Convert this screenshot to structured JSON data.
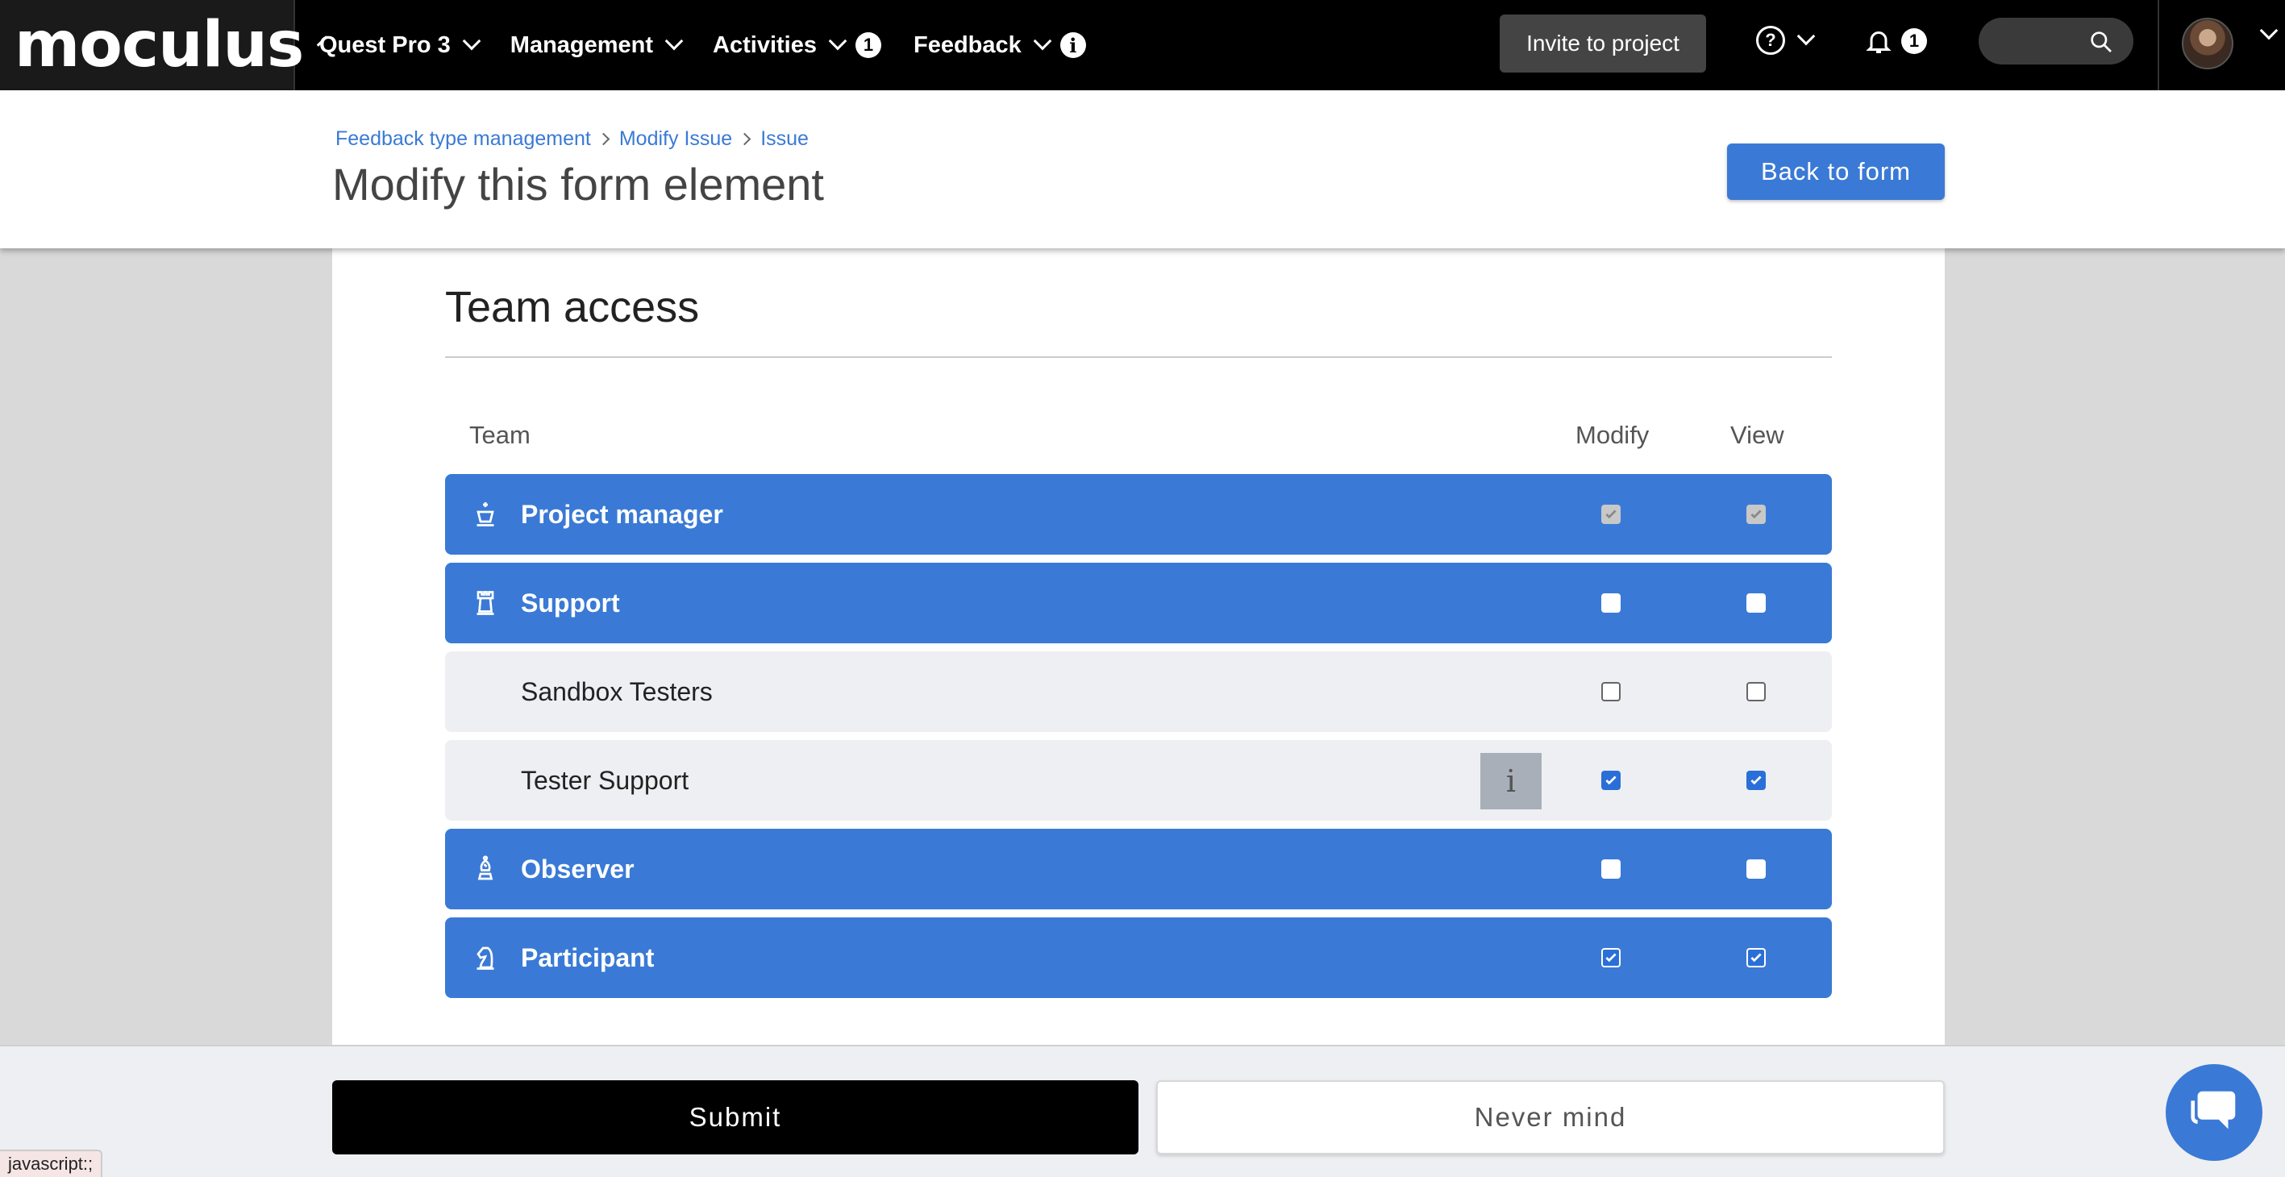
{
  "topbar": {
    "logo": "moculus",
    "nav": [
      {
        "label": "Quest Pro 3"
      },
      {
        "label": "Management"
      },
      {
        "label": "Activities",
        "badge": "1"
      },
      {
        "label": "Feedback",
        "info": "i"
      }
    ],
    "invite_label": "Invite to project",
    "help_glyph": "?",
    "notification_count": "1",
    "search_icon": "search-icon"
  },
  "header": {
    "breadcrumb": [
      "Feedback type management",
      "Modify Issue",
      "Issue"
    ],
    "title": "Modify this form element",
    "back_label": "Back to form"
  },
  "team_access": {
    "title": "Team access",
    "columns": {
      "team": "Team",
      "modify": "Modify",
      "view": "View"
    },
    "rows": [
      {
        "name": "Project manager",
        "style": "blue",
        "icon": "crown-icon",
        "modify": "checked-disabled",
        "view": "checked-disabled"
      },
      {
        "name": "Support",
        "style": "blue",
        "icon": "rook-icon",
        "modify": "unchecked",
        "view": "unchecked"
      },
      {
        "name": "Sandbox Testers",
        "style": "grey",
        "icon": "",
        "modify": "unchecked",
        "view": "unchecked"
      },
      {
        "name": "Tester Support",
        "style": "grey",
        "icon": "",
        "modify": "checked",
        "view": "checked",
        "info_tip": "i"
      },
      {
        "name": "Observer",
        "style": "blue",
        "icon": "bishop-icon",
        "modify": "unchecked",
        "view": "unchecked"
      },
      {
        "name": "Participant",
        "style": "blue",
        "icon": "knight-icon",
        "modify": "checked",
        "view": "checked"
      }
    ]
  },
  "footer": {
    "submit_label": "Submit",
    "cancel_label": "Never mind"
  },
  "status_bar": "javascript:;",
  "colors": {
    "accent": "#3a7ad6",
    "topbar": "#000000",
    "row_grey": "#eeeff2"
  }
}
